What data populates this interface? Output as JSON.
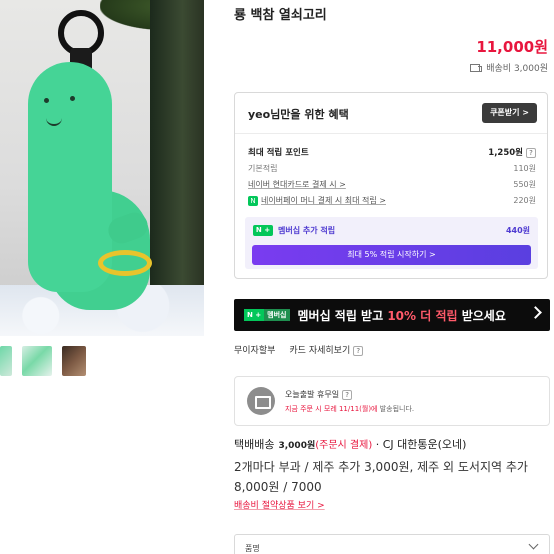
{
  "product": {
    "title": "룡 백참 열쇠고리",
    "price": "11,000원",
    "shipping_fee": "배송비 3,000원"
  },
  "benefits": {
    "title": "yeo님만을 위한 혜택",
    "coupon_button": "쿠폰받기 >",
    "max_points_label": "최대 적립 포인트",
    "max_points_value": "1,250원",
    "help": "?",
    "rows": [
      {
        "label": "기본적립",
        "value": "110원"
      },
      {
        "label": "네이버 현대카드로 결제 시 >",
        "value": "550원"
      },
      {
        "badge": "N",
        "label": "네이버페이 머니 결제 시 최대 적립 >",
        "value": "220원"
      }
    ],
    "membership_badge": "N +",
    "membership_label": "멤버십 추가 적립",
    "membership_value": "440원",
    "membership_button": "최대 5% 적립 시작하기 >"
  },
  "banner": {
    "badge_left": "N +",
    "badge_right": "멤버십",
    "text_before": "멤버십 적립 받고 ",
    "text_accent": "10% 더 적립",
    "text_after": " 받으세요"
  },
  "meta_links": {
    "installment": "무이자할부",
    "card_benefit": "카드 자세히보기",
    "help": "?"
  },
  "delivery": {
    "title": "오늘출발 휴무일",
    "help": "?",
    "sub_red": "지금 주문 시 모레 11/11(월)에",
    "sub_gray": " 발송됩니다."
  },
  "shipping": {
    "method": "택배배송",
    "fee": "3,000원",
    "condition": "(주문시 결제)",
    "carrier": " · CJ 대한통운(오네)",
    "extra": "2개마다 부과 / 제주 추가 3,000원, 제주 외 도서지역 추가 8,000원 / 7000",
    "bundle_link": "배송비 절약상품 보기 >"
  },
  "option": {
    "label": "품명"
  }
}
